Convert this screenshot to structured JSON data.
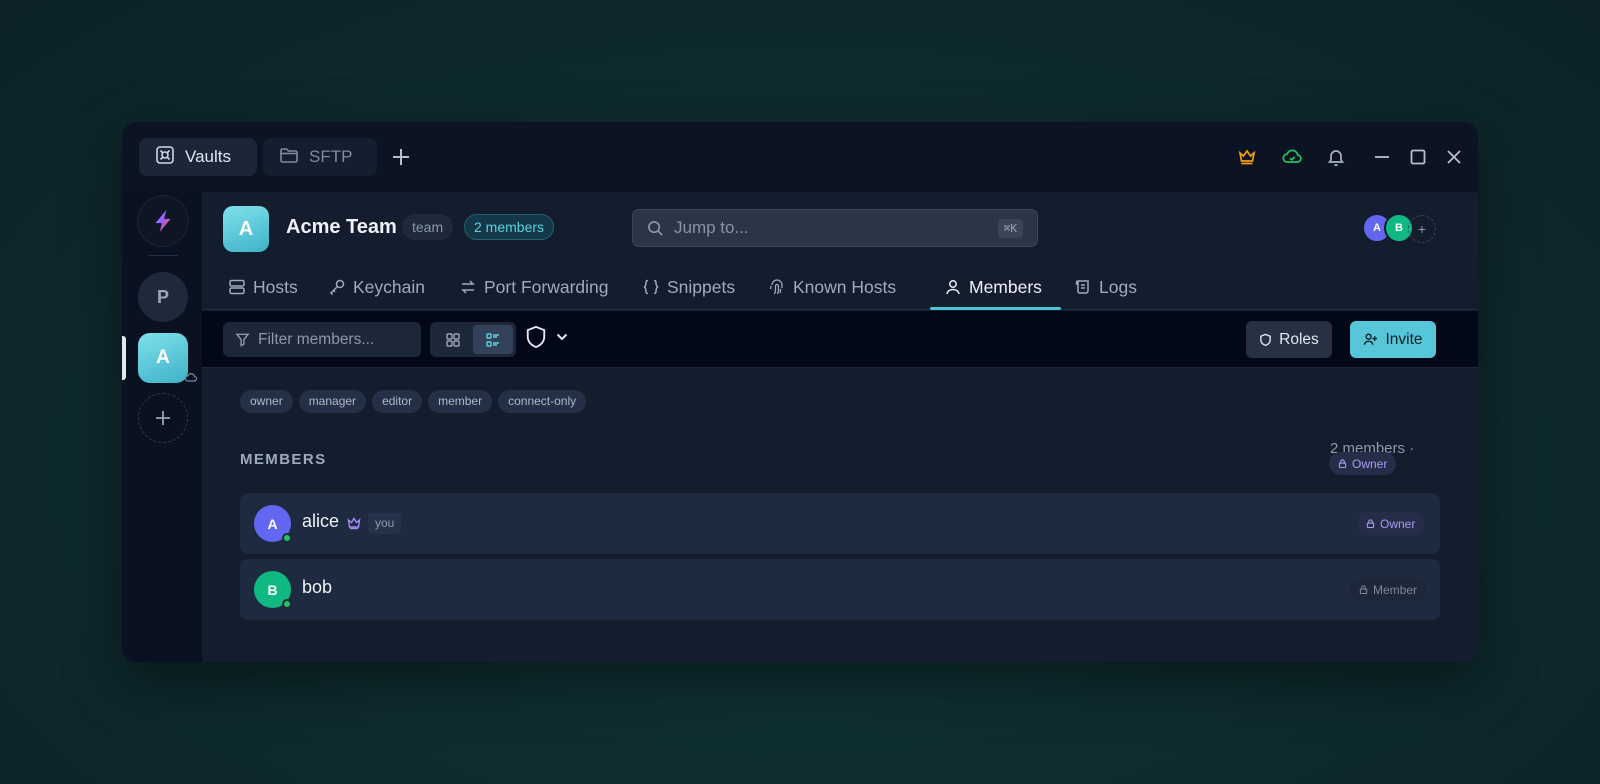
{
  "titlebar": {
    "tabs": [
      {
        "label": "Vaults",
        "icon": "vault-icon",
        "active": true
      },
      {
        "label": "SFTP",
        "icon": "folder-icon",
        "active": false
      }
    ],
    "icons": [
      "crown-icon",
      "cloud-sync-icon",
      "bell-icon",
      "minimize-icon",
      "maximize-icon",
      "close-icon"
    ],
    "colors": {
      "crown": "#f59e0b",
      "cloud": "#22c55e"
    }
  },
  "rail": {
    "items": [
      {
        "letter": "P",
        "name": "personal-vault"
      },
      {
        "letter": "A",
        "name": "acme-team-vault",
        "selected": true
      }
    ]
  },
  "header": {
    "avatar_letter": "A",
    "team_name": "Acme Team",
    "type_badge": "team",
    "members_badge": "2 members",
    "search_placeholder": "Jump to...",
    "search_shortcut": "⌘K",
    "presence": [
      {
        "letter": "A",
        "color": "#6366f1"
      },
      {
        "letter": "B",
        "color": "#10b981"
      }
    ],
    "presence_add": "+"
  },
  "nav": {
    "tabs": [
      {
        "label": "Hosts",
        "icon": "server-icon"
      },
      {
        "label": "Keychain",
        "icon": "key-icon"
      },
      {
        "label": "Port Forwarding",
        "icon": "arrows-icon"
      },
      {
        "label": "Snippets",
        "icon": "braces-icon"
      },
      {
        "label": "Known Hosts",
        "icon": "fingerprint-icon"
      },
      {
        "label": "Members",
        "icon": "user-icon",
        "active": true
      },
      {
        "label": "Logs",
        "icon": "scroll-icon"
      }
    ]
  },
  "toolbar": {
    "filter_placeholder": "Filter members...",
    "view_mode": "list",
    "roles_label": "Roles",
    "invite_label": "Invite"
  },
  "roles": [
    "owner",
    "manager",
    "editor",
    "member",
    "connect-only"
  ],
  "members_section": {
    "title": "MEMBERS",
    "count_text": "2 members ·",
    "my_role": "Owner",
    "members": [
      {
        "initial": "A",
        "name": "alice",
        "color": "#6366f1",
        "online": true,
        "is_you": true,
        "you_label": "you",
        "role": "Owner"
      },
      {
        "initial": "B",
        "name": "bob",
        "color": "#10b981",
        "online": true,
        "is_you": false,
        "role": "Member"
      }
    ]
  }
}
